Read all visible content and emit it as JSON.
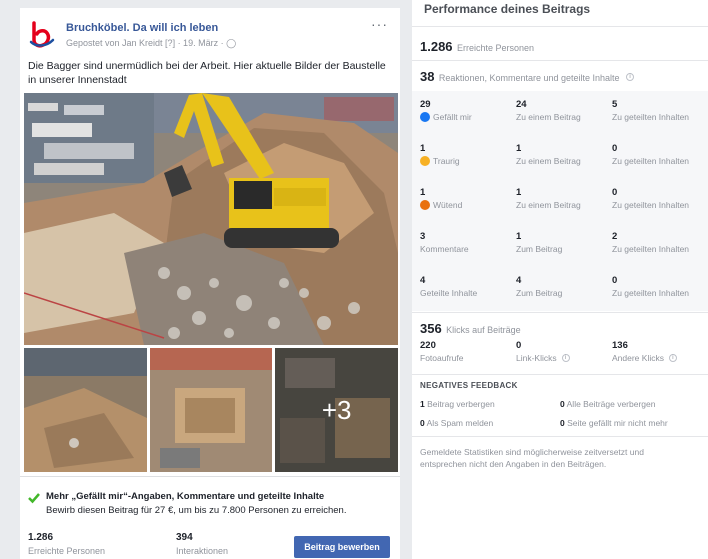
{
  "post": {
    "page_name": "Bruchköbel. Da will ich leben",
    "meta": "Gepostet von Jan Kreidt [?] · 19. März · ",
    "globe_icon": "globe-icon",
    "more": "···",
    "text": "Die Bagger sind unermüdlich bei der Arbeit. Hier aktuelle Bilder der Baustelle in unserer Innenstadt",
    "more_photos": "+3",
    "promo": {
      "title": "Mehr „Gefällt mir“-Angaben, Kommentare und geteilte Inhalte",
      "subtitle": "Bewirb diesen Beitrag für 27 €, um bis zu 7.800 Personen zu erreichen."
    },
    "stats": [
      {
        "num": "1.286",
        "label": "Erreichte Personen"
      },
      {
        "num": "394",
        "label": "Interaktionen"
      }
    ],
    "boost_label": "Beitrag bewerben"
  },
  "perf": {
    "title": "Performance deines Beitrags",
    "reach": {
      "num": "1.286",
      "label": "Erreichte Personen"
    },
    "reactions_head": {
      "num": "38",
      "label": "Reaktionen, Kommentare und geteilte Inhalte"
    },
    "rows": [
      {
        "num1": "29",
        "label1": "Gefällt mir",
        "num2": "24",
        "label2": "Zu einem Beitrag",
        "num3": "5",
        "label3": "Zu geteilten Inhalten",
        "icon_color": "#1877f2"
      },
      {
        "num1": "1",
        "label1": "Traurig",
        "num2": "1",
        "label2": "Zu einem Beitrag",
        "num3": "0",
        "label3": "Zu geteilten Inhalten",
        "icon_color": "#f7b125"
      },
      {
        "num1": "1",
        "label1": "Wütend",
        "num2": "1",
        "label2": "Zu einem Beitrag",
        "num3": "0",
        "label3": "Zu geteilten Inhalten",
        "icon_color": "#e9710f"
      },
      {
        "num1": "3",
        "label1": "Kommentare",
        "num2": "1",
        "label2": "Zum Beitrag",
        "num3": "2",
        "label3": "Zu geteilten Inhalten",
        "icon_color": ""
      },
      {
        "num1": "4",
        "label1": "Geteilte Inhalte",
        "num2": "4",
        "label2": "Zum Beitrag",
        "num3": "0",
        "label3": "Zu geteilten Inhalten",
        "icon_color": ""
      }
    ],
    "clicks_head": {
      "num": "356",
      "label": "Klicks auf Beiträge"
    },
    "clicks": [
      {
        "num": "220",
        "label": "Fotoaufrufe"
      },
      {
        "num": "0",
        "label": "Link-Klicks"
      },
      {
        "num": "136",
        "label": "Andere Klicks"
      }
    ],
    "negative": {
      "head": "NEGATIVES FEEDBACK",
      "items": [
        {
          "num": "1",
          "label": "Beitrag verbergen"
        },
        {
          "num": "0",
          "label": "Alle Beiträge verbergen"
        },
        {
          "num": "0",
          "label": "Als Spam melden"
        },
        {
          "num": "0",
          "label": "Seite gefällt mir nicht mehr"
        }
      ]
    },
    "note": "Gemeldete Statistiken sind möglicherweise zeitversetzt und entsprechen nicht den Angaben in den Beiträgen."
  },
  "colors": {
    "accent": "#4267b2",
    "link": "#385898",
    "logo_red": "#e4001b",
    "logo_blue": "#1d4fa0",
    "check": "#42b72a"
  }
}
